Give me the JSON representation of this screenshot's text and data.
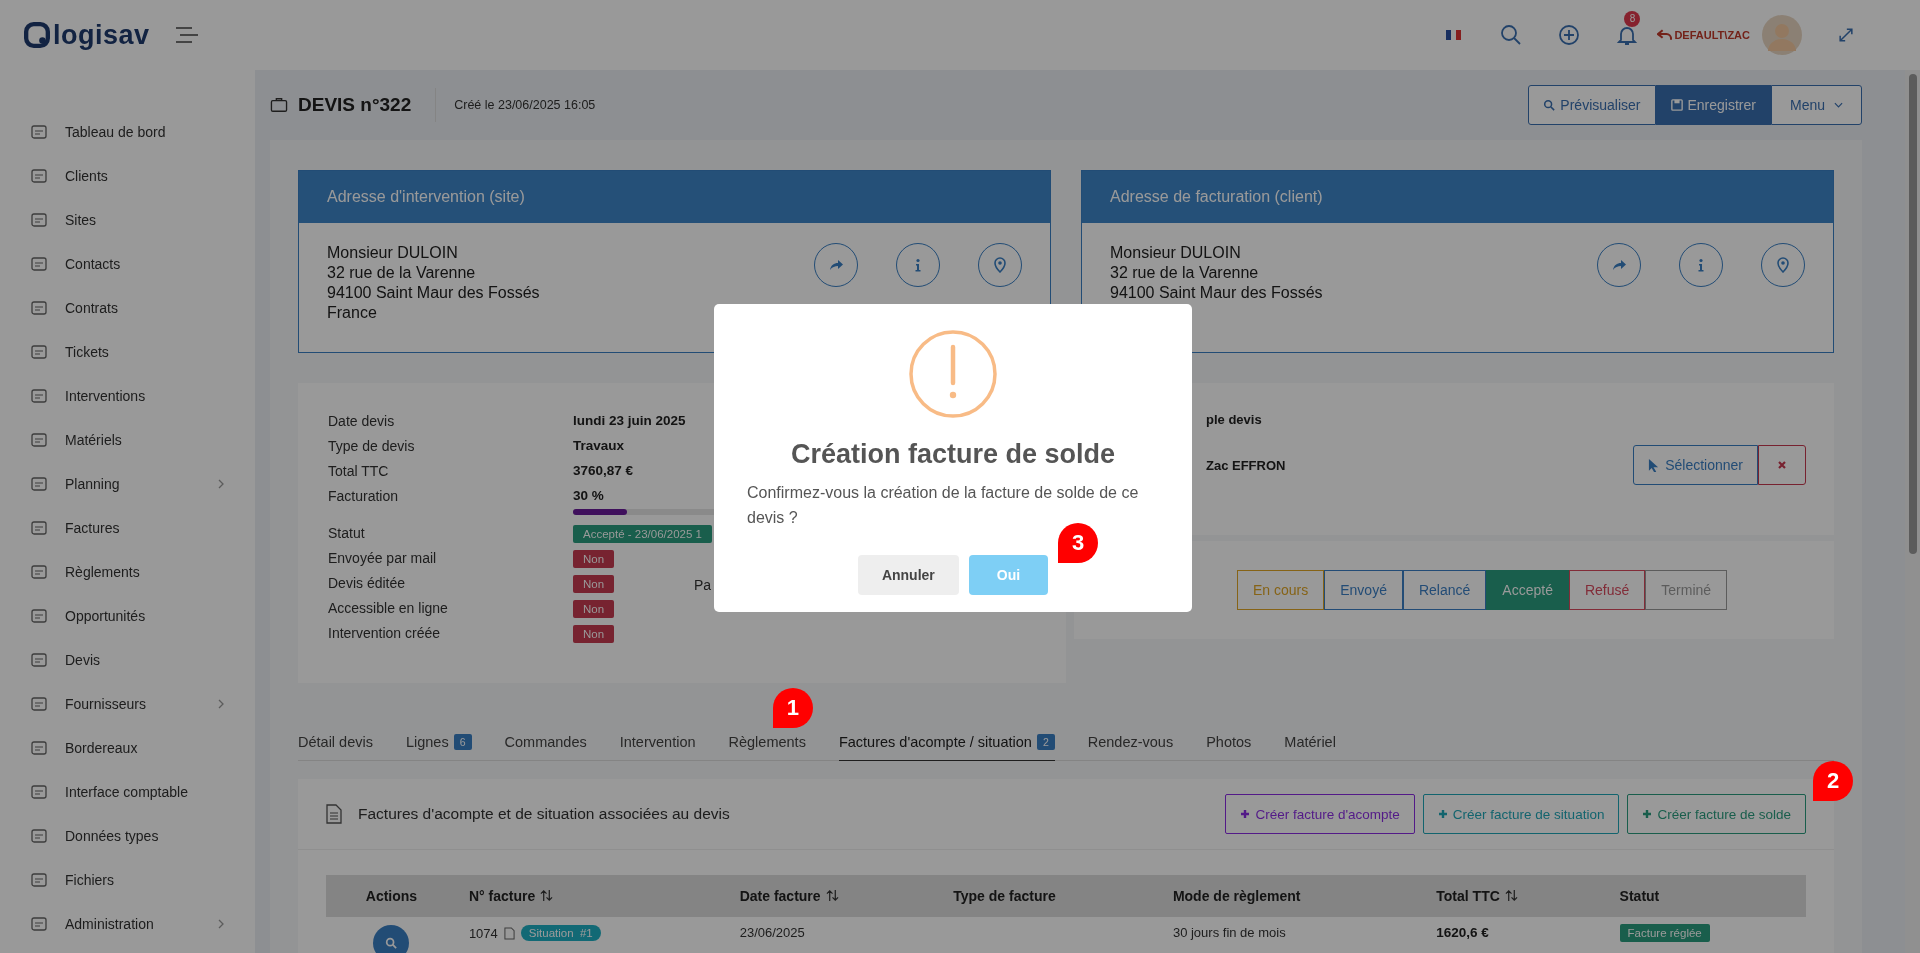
{
  "header": {
    "logo": "logisav",
    "notification_count": "8",
    "user": "DEFAULT\\ZAC"
  },
  "sidebar": {
    "items": [
      {
        "label": "Tableau de bord",
        "has_submenu": false
      },
      {
        "label": "Clients",
        "has_submenu": false
      },
      {
        "label": "Sites",
        "has_submenu": false
      },
      {
        "label": "Contacts",
        "has_submenu": false
      },
      {
        "label": "Contrats",
        "has_submenu": false
      },
      {
        "label": "Tickets",
        "has_submenu": false
      },
      {
        "label": "Interventions",
        "has_submenu": false
      },
      {
        "label": "Matériels",
        "has_submenu": false
      },
      {
        "label": "Planning",
        "has_submenu": true
      },
      {
        "label": "Factures",
        "has_submenu": false
      },
      {
        "label": "Règlements",
        "has_submenu": false
      },
      {
        "label": "Opportunités",
        "has_submenu": false
      },
      {
        "label": "Devis",
        "has_submenu": false
      },
      {
        "label": "Fournisseurs",
        "has_submenu": true
      },
      {
        "label": "Bordereaux",
        "has_submenu": false
      },
      {
        "label": "Interface comptable",
        "has_submenu": false
      },
      {
        "label": "Données types",
        "has_submenu": false
      },
      {
        "label": "Fichiers",
        "has_submenu": false
      },
      {
        "label": "Administration",
        "has_submenu": true
      }
    ]
  },
  "page": {
    "title": "DEVIS n°322",
    "created": "Créé le 23/06/2025 16:05",
    "preview_button": "Prévisualiser",
    "save_button": "Enregistrer",
    "menu_button": "Menu"
  },
  "addresses": [
    {
      "title": "Adresse d'intervention (site)",
      "lines": [
        "Monsieur DULOIN",
        "32 rue de la Varenne",
        "94100 Saint Maur des Fossés",
        "France"
      ]
    },
    {
      "title": "Adresse de facturation (client)",
      "lines": [
        "Monsieur DULOIN",
        "32 rue de la Varenne",
        "94100 Saint Maur des Fossés"
      ]
    }
  ],
  "details": [
    {
      "label": "Date devis",
      "kind": "text",
      "value": "lundi 23 juin 2025"
    },
    {
      "label": "Type de devis",
      "kind": "text",
      "value": "Travaux"
    },
    {
      "label": "Total TTC",
      "kind": "text",
      "value": "3760,87 €"
    },
    {
      "label": "Facturation",
      "kind": "progress",
      "value": "30 %",
      "level": 0.3
    },
    {
      "label": "Statut",
      "kind": "badge",
      "value": "Accepté - 23/06/2025 1",
      "color": "#195e4c"
    },
    {
      "label": "Envoyée par mail",
      "kind": "badge",
      "value": "Non",
      "color": "#772330"
    },
    {
      "label": "Devis éditée",
      "kind": "badge",
      "value": "Non",
      "color": "#772330",
      "side_label": "Pa"
    },
    {
      "label": "Accessible en ligne",
      "kind": "badge",
      "value": "Non",
      "color": "#772330"
    },
    {
      "label": "Intervention créée",
      "kind": "badge",
      "value": "Non",
      "color": "#772330"
    }
  ],
  "responsible": {
    "title": "ple devis",
    "name": "Zac EFFRON",
    "select_button": "Sélectionner"
  },
  "status_steps": [
    {
      "label": "En cours",
      "color": "#866316",
      "selected": false
    },
    {
      "label": "Envoyé",
      "color": "#234c76",
      "selected": false
    },
    {
      "label": "Relancé",
      "color": "#234c76",
      "selected": false
    },
    {
      "label": "Accepté",
      "color": "#195e4c",
      "selected": true
    },
    {
      "label": "Refusé",
      "color": "#822c38",
      "selected": false
    },
    {
      "label": "Terminé",
      "color": "#5c5c5c",
      "selected": false
    }
  ],
  "tabs": [
    {
      "label": "Détail devis",
      "selected": false
    },
    {
      "label": "Lignes",
      "count": "6",
      "selected": false
    },
    {
      "label": "Commandes",
      "selected": false
    },
    {
      "label": "Intervention",
      "selected": false
    },
    {
      "label": "Règlements",
      "selected": false
    },
    {
      "label": "Factures d'acompte / situation",
      "count": "2",
      "selected": true,
      "callout": "1"
    },
    {
      "label": "Rendez-vous",
      "selected": false
    },
    {
      "label": "Photos",
      "selected": false
    },
    {
      "label": "Matériel",
      "selected": false
    }
  ],
  "section": {
    "title": "Factures d'acompte et de situation associées au devis",
    "buttons": [
      {
        "label": "Créer facture d'acompte",
        "color": "#531a88"
      },
      {
        "label": "Créer facture de situation",
        "color": "#12646e"
      },
      {
        "label": "Créer facture de solde",
        "color": "#195e4c",
        "callout": "2"
      }
    ]
  },
  "table": {
    "columns": [
      {
        "label": "Actions",
        "sortable": false
      },
      {
        "label": "N° facture",
        "sortable": true
      },
      {
        "label": "Date facture",
        "sortable": true
      },
      {
        "label": "Type de facture",
        "sortable": false
      },
      {
        "label": "Mode de règlement",
        "sortable": false
      },
      {
        "label": "Total TTC",
        "sortable": true
      },
      {
        "label": "Statut",
        "sortable": false
      }
    ],
    "rows": [
      {
        "number": "1074",
        "tag": "Situation",
        "tag_index": "#1",
        "date": "23/06/2025",
        "payment": "30 jours fin de mois",
        "total": "1620,6 €",
        "status": "Facture réglée"
      }
    ]
  },
  "modal": {
    "title": "Création facture de solde",
    "message": "Confirmez-vous la création de la facture de solde de ce devis ?",
    "buttons": [
      {
        "label": "Annuler",
        "kind": "cancel"
      },
      {
        "label": "Oui",
        "kind": "confirm",
        "callout": "3"
      }
    ]
  }
}
